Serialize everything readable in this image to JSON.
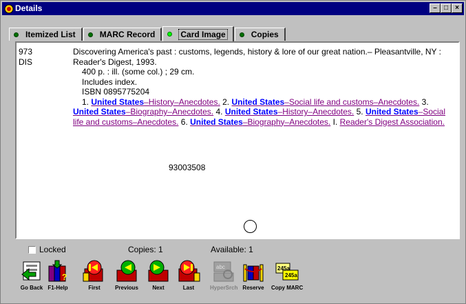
{
  "window": {
    "title": "Details"
  },
  "tabs": [
    {
      "label": "Itemized List"
    },
    {
      "label": "MARC Record"
    },
    {
      "label": "Card Image"
    },
    {
      "label": "Copies"
    }
  ],
  "card": {
    "call_number_line1": "973",
    "call_number_line2": "DIS",
    "title_line": "Discovering America's past : customs, legends, history & lore of our great nation.– Pleasantville, NY : Reader's Digest, 1993.",
    "physical": "400 p. : ill. (some col.) ; 29 cm.",
    "note": "Includes index.",
    "isbn": "ISBN 0895775204",
    "tracings": [
      {
        "num": "1.",
        "heading": "United States",
        "sub": "–History–Anecdotes."
      },
      {
        "num": "2.",
        "heading": "United States",
        "sub": "–Social life and customs–Anecdotes."
      },
      {
        "num": "3.",
        "heading": "United States",
        "sub": "–Biography–Anecdotes."
      },
      {
        "num": "4.",
        "heading": "United States",
        "sub": "–History–Anecdotes."
      },
      {
        "num": "5.",
        "heading": "United States",
        "sub": "–Social life and customs–Anecdotes."
      },
      {
        "num": "6.",
        "heading": "United States",
        "sub": "–Biography–Anecdotes."
      },
      {
        "num": "I.",
        "heading": "",
        "sub": "Reader's Digest Association."
      }
    ],
    "lccn": "93003508"
  },
  "status": {
    "locked_label": "Locked",
    "copies": "Copies: 1",
    "available": "Available: 1"
  },
  "toolbar": [
    {
      "label": "Go Back",
      "icon": "go-back-icon",
      "enabled": true
    },
    {
      "label": "F1-Help",
      "icon": "help-books-icon",
      "enabled": true
    },
    {
      "label": "First",
      "icon": "first-record-icon",
      "enabled": true
    },
    {
      "label": "Previous",
      "icon": "previous-record-icon",
      "enabled": true
    },
    {
      "label": "Next",
      "icon": "next-record-icon",
      "enabled": true
    },
    {
      "label": "Last",
      "icon": "last-record-icon",
      "enabled": true
    },
    {
      "label": "HyperSrch",
      "icon": "hypersearch-icon",
      "enabled": false
    },
    {
      "label": "Reserve",
      "icon": "reserve-icon",
      "enabled": true
    },
    {
      "label": "Copy MARC",
      "icon": "copy-marc-icon",
      "enabled": true
    }
  ],
  "colors": {
    "titlebar": "#000080",
    "link": "#800080",
    "heading_link": "#0000ff",
    "tab_dot": "#00ff00"
  }
}
